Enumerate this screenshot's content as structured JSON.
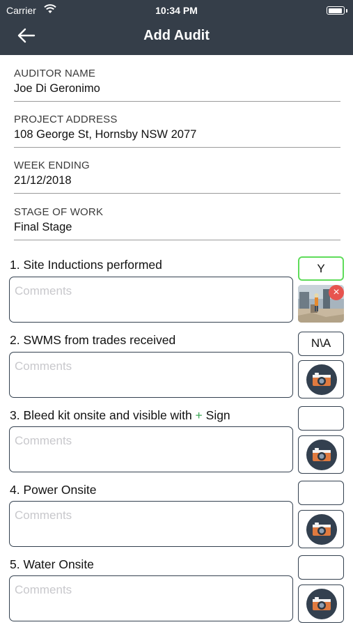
{
  "status_bar": {
    "carrier": "Carrier",
    "time": "10:34 PM",
    "battery_level": 0.95
  },
  "header": {
    "title": "Add Audit",
    "back_icon": "arrow-left-icon"
  },
  "fields": [
    {
      "label": "AUDITOR NAME",
      "value": "Joe Di Geronimo"
    },
    {
      "label": "PROJECT ADDRESS",
      "value": "108 George St, Hornsby NSW 2077"
    },
    {
      "label": "WEEK ENDING",
      "value": "21/12/2018"
    },
    {
      "label": "STAGE OF WORK",
      "value": "Final Stage"
    }
  ],
  "comment_placeholder": "Comments",
  "questions": [
    {
      "title": "1. Site Inductions performed",
      "answer": "Y",
      "answer_selected": true,
      "has_photo": true
    },
    {
      "title": "2. SWMS from trades received",
      "answer": "N\\A",
      "answer_selected": false,
      "has_photo": false
    },
    {
      "title_before": "3. Bleed kit onsite and visible with ",
      "title_symbol": "+",
      "title_after": " Sign",
      "answer": "",
      "answer_selected": false,
      "has_photo": false
    },
    {
      "title": "4. Power Onsite",
      "answer": "",
      "answer_selected": false,
      "has_photo": false
    },
    {
      "title": "5. Water Onsite",
      "answer": "",
      "answer_selected": false,
      "has_photo": false
    }
  ],
  "colors": {
    "header_bg": "#353e49",
    "selected_border": "#5fdc5a",
    "camera_circle": "#33404f",
    "camera_body": "#e07a3f",
    "remove_badge": "#e7544f",
    "plus_symbol": "#3aa655"
  }
}
